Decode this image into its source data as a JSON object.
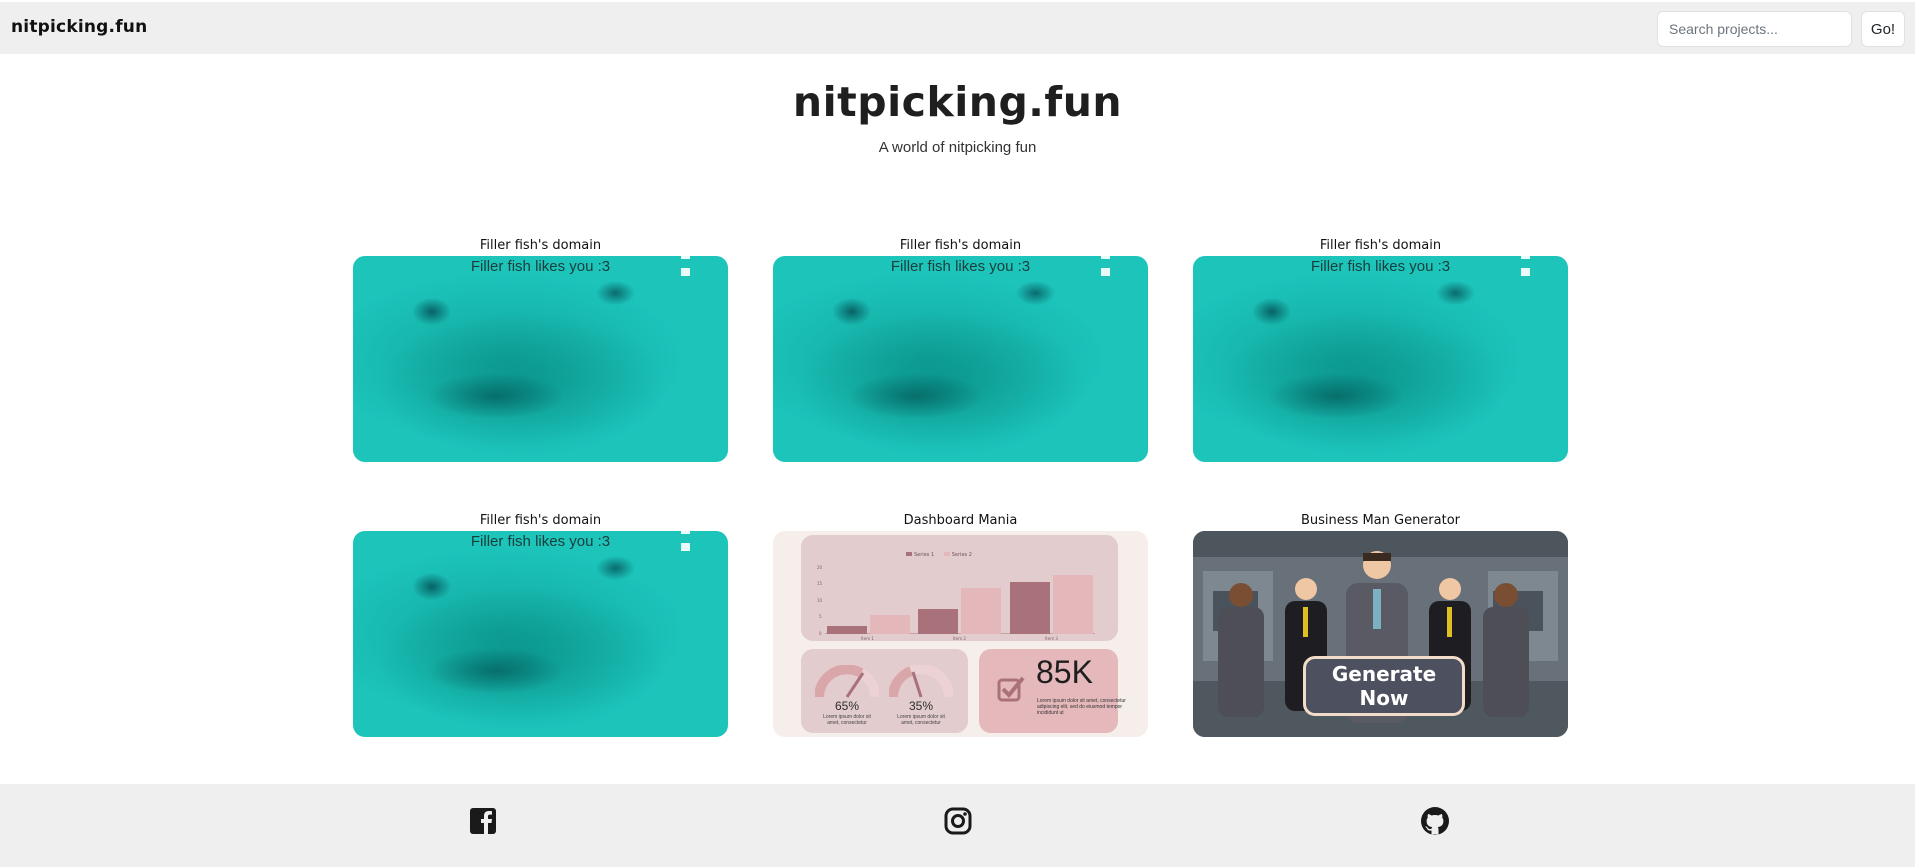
{
  "navbar": {
    "brand": "nitpicking.fun",
    "search_placeholder": "Search projects...",
    "go_label": "Go!"
  },
  "hero": {
    "title": "nitpicking.fun",
    "subtitle": "A world of nitpicking fun"
  },
  "cards": [
    {
      "title": "Filler fish's domain",
      "caption": "Filler fish likes you :3"
    },
    {
      "title": "Filler fish's domain",
      "caption": "Filler fish likes you :3"
    },
    {
      "title": "Filler fish's domain",
      "caption": "Filler fish likes you :3"
    },
    {
      "title": "Filler fish's domain",
      "caption": "Filler fish likes you :3"
    },
    {
      "title": "Dashboard Mania"
    },
    {
      "title": "Business Man Generator",
      "button_label": "Generate Now"
    }
  ],
  "dashboard_thumbnail": {
    "legend": [
      "Series 1",
      "Series 2"
    ],
    "y_ticks": [
      "20",
      "15",
      "10",
      "5",
      "0"
    ],
    "x_labels": [
      "Item 1",
      "Item 2",
      "Item 3"
    ],
    "gauge_left_value": "65%",
    "gauge_left_caption": "Lorem ipsum dolor sit amet, consectetur",
    "gauge_right_value": "35%",
    "gauge_right_caption": "Lorem ipsum dolor sit amet, consectetur",
    "kpi_value": "85K",
    "kpi_caption": "Lorem ipsum dolor sit amet, consectetur adipiscing elit, sed do eiusmod tempor incididunt ut"
  },
  "footer": {
    "icons": [
      "facebook-icon",
      "instagram-icon",
      "github-icon"
    ]
  },
  "colors": {
    "navbar_bg": "#efefef",
    "footer_bg": "#efefef",
    "fish_teal": "#1bc3b8",
    "dashboard_bg": "#f6eeea",
    "series_1": "#a9727a",
    "series_2": "#e4b7ba",
    "generate_button_bg": "#4c505f"
  }
}
